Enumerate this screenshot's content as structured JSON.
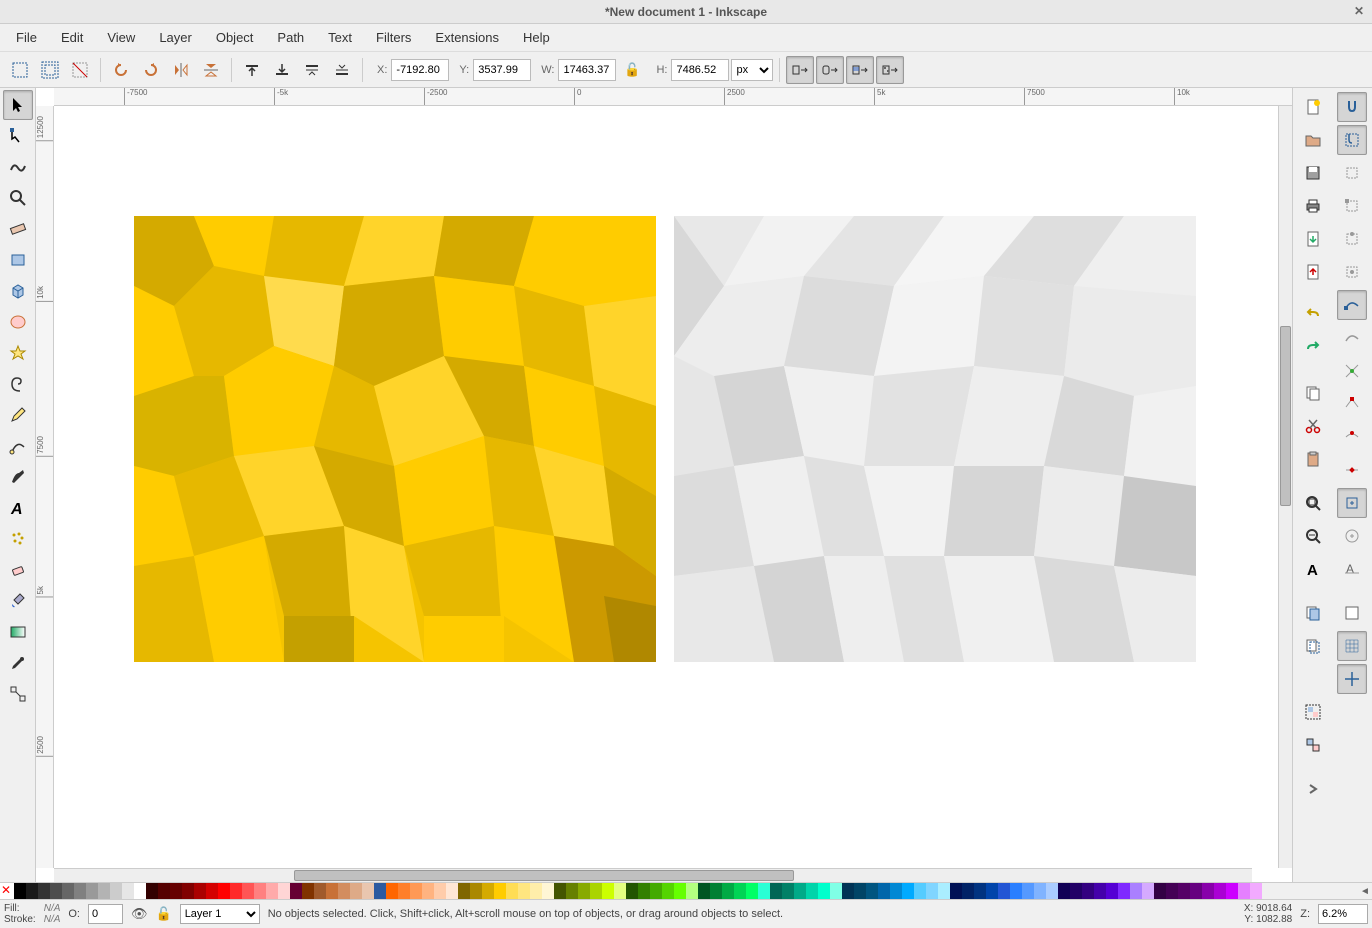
{
  "title": "*New document 1 - Inkscape",
  "menus": [
    "File",
    "Edit",
    "View",
    "Layer",
    "Object",
    "Path",
    "Text",
    "Filters",
    "Extensions",
    "Help"
  ],
  "coords": {
    "x_label": "X:",
    "x": "-7192.80",
    "y_label": "Y:",
    "y": "3537.99",
    "w_label": "W:",
    "w": "17463.37",
    "h_label": "H:",
    "h": "7486.52",
    "unit": "px"
  },
  "hruler": [
    {
      "pos": 70,
      "label": "-7500"
    },
    {
      "pos": 220,
      "label": "-5k"
    },
    {
      "pos": 370,
      "label": "-2500"
    },
    {
      "pos": 520,
      "label": "0"
    },
    {
      "pos": 670,
      "label": "2500"
    },
    {
      "pos": 820,
      "label": "5k"
    },
    {
      "pos": 970,
      "label": "7500"
    },
    {
      "pos": 1120,
      "label": "10k"
    }
  ],
  "vruler": [
    {
      "pos": 10,
      "label": "12500"
    },
    {
      "pos": 180,
      "label": "10k"
    },
    {
      "pos": 330,
      "label": "7500"
    },
    {
      "pos": 480,
      "label": "5k"
    },
    {
      "pos": 630,
      "label": "2500"
    }
  ],
  "status": {
    "fill_label": "Fill:",
    "fill_value": "N/A",
    "stroke_label": "Stroke:",
    "stroke_value": "N/A",
    "opacity_label": "O:",
    "opacity": "0",
    "layer": "Layer 1",
    "message": "No objects selected. Click, Shift+click, Alt+scroll mouse on top of objects, or drag around objects to select.",
    "cursor_x_label": "X:",
    "cursor_x": "9018.64",
    "cursor_y_label": "Y:",
    "cursor_y": "1082.88",
    "zoom_label": "Z:",
    "zoom": "6.2%"
  },
  "palette": [
    "#000000",
    "#1a1a1a",
    "#333333",
    "#4d4d4d",
    "#666666",
    "#808080",
    "#999999",
    "#b3b3b3",
    "#cccccc",
    "#e6e6e6",
    "#ffffff",
    "#330000",
    "#550000",
    "#660000",
    "#800000",
    "#aa0000",
    "#d40000",
    "#ff0000",
    "#ff2a2a",
    "#ff5555",
    "#ff8080",
    "#ffaaaa",
    "#ffd5d5",
    "#660033",
    "#803300",
    "#a05a2c",
    "#c87137",
    "#d38d5f",
    "#deaa87",
    "#e9c6af",
    "#2c5aa0",
    "#ff6600",
    "#ff7f2a",
    "#ff9955",
    "#ffb380",
    "#ffccaa",
    "#ffe6d5",
    "#806600",
    "#aa8800",
    "#d4aa00",
    "#ffcc00",
    "#ffdd55",
    "#ffe680",
    "#ffeeaa",
    "#fff6d5",
    "#445500",
    "#668000",
    "#88aa00",
    "#aad400",
    "#ccff00",
    "#e3ff80",
    "#225500",
    "#338000",
    "#44aa00",
    "#55d400",
    "#66ff00",
    "#b3ff80",
    "#005522",
    "#008033",
    "#00aa44",
    "#00d455",
    "#00ff66",
    "#2affd5",
    "#006655",
    "#008066",
    "#00aa88",
    "#00d4aa",
    "#00ffcc",
    "#80ffe6",
    "#003355",
    "#004466",
    "#005580",
    "#0066aa",
    "#0088d4",
    "#00aaff",
    "#55ccff",
    "#80d5ff",
    "#aaeeff",
    "#001155",
    "#002266",
    "#003380",
    "#0044aa",
    "#2255d4",
    "#2a7fff",
    "#5599ff",
    "#80b3ff",
    "#aaccff",
    "#110055",
    "#220066",
    "#330080",
    "#4400aa",
    "#5500d4",
    "#7f2aff",
    "#aa80ff",
    "#d5aaff",
    "#330044",
    "#440055",
    "#550066",
    "#660080",
    "#8800aa",
    "#aa00d4",
    "#cc00ff",
    "#e580ff",
    "#f2aaff"
  ]
}
